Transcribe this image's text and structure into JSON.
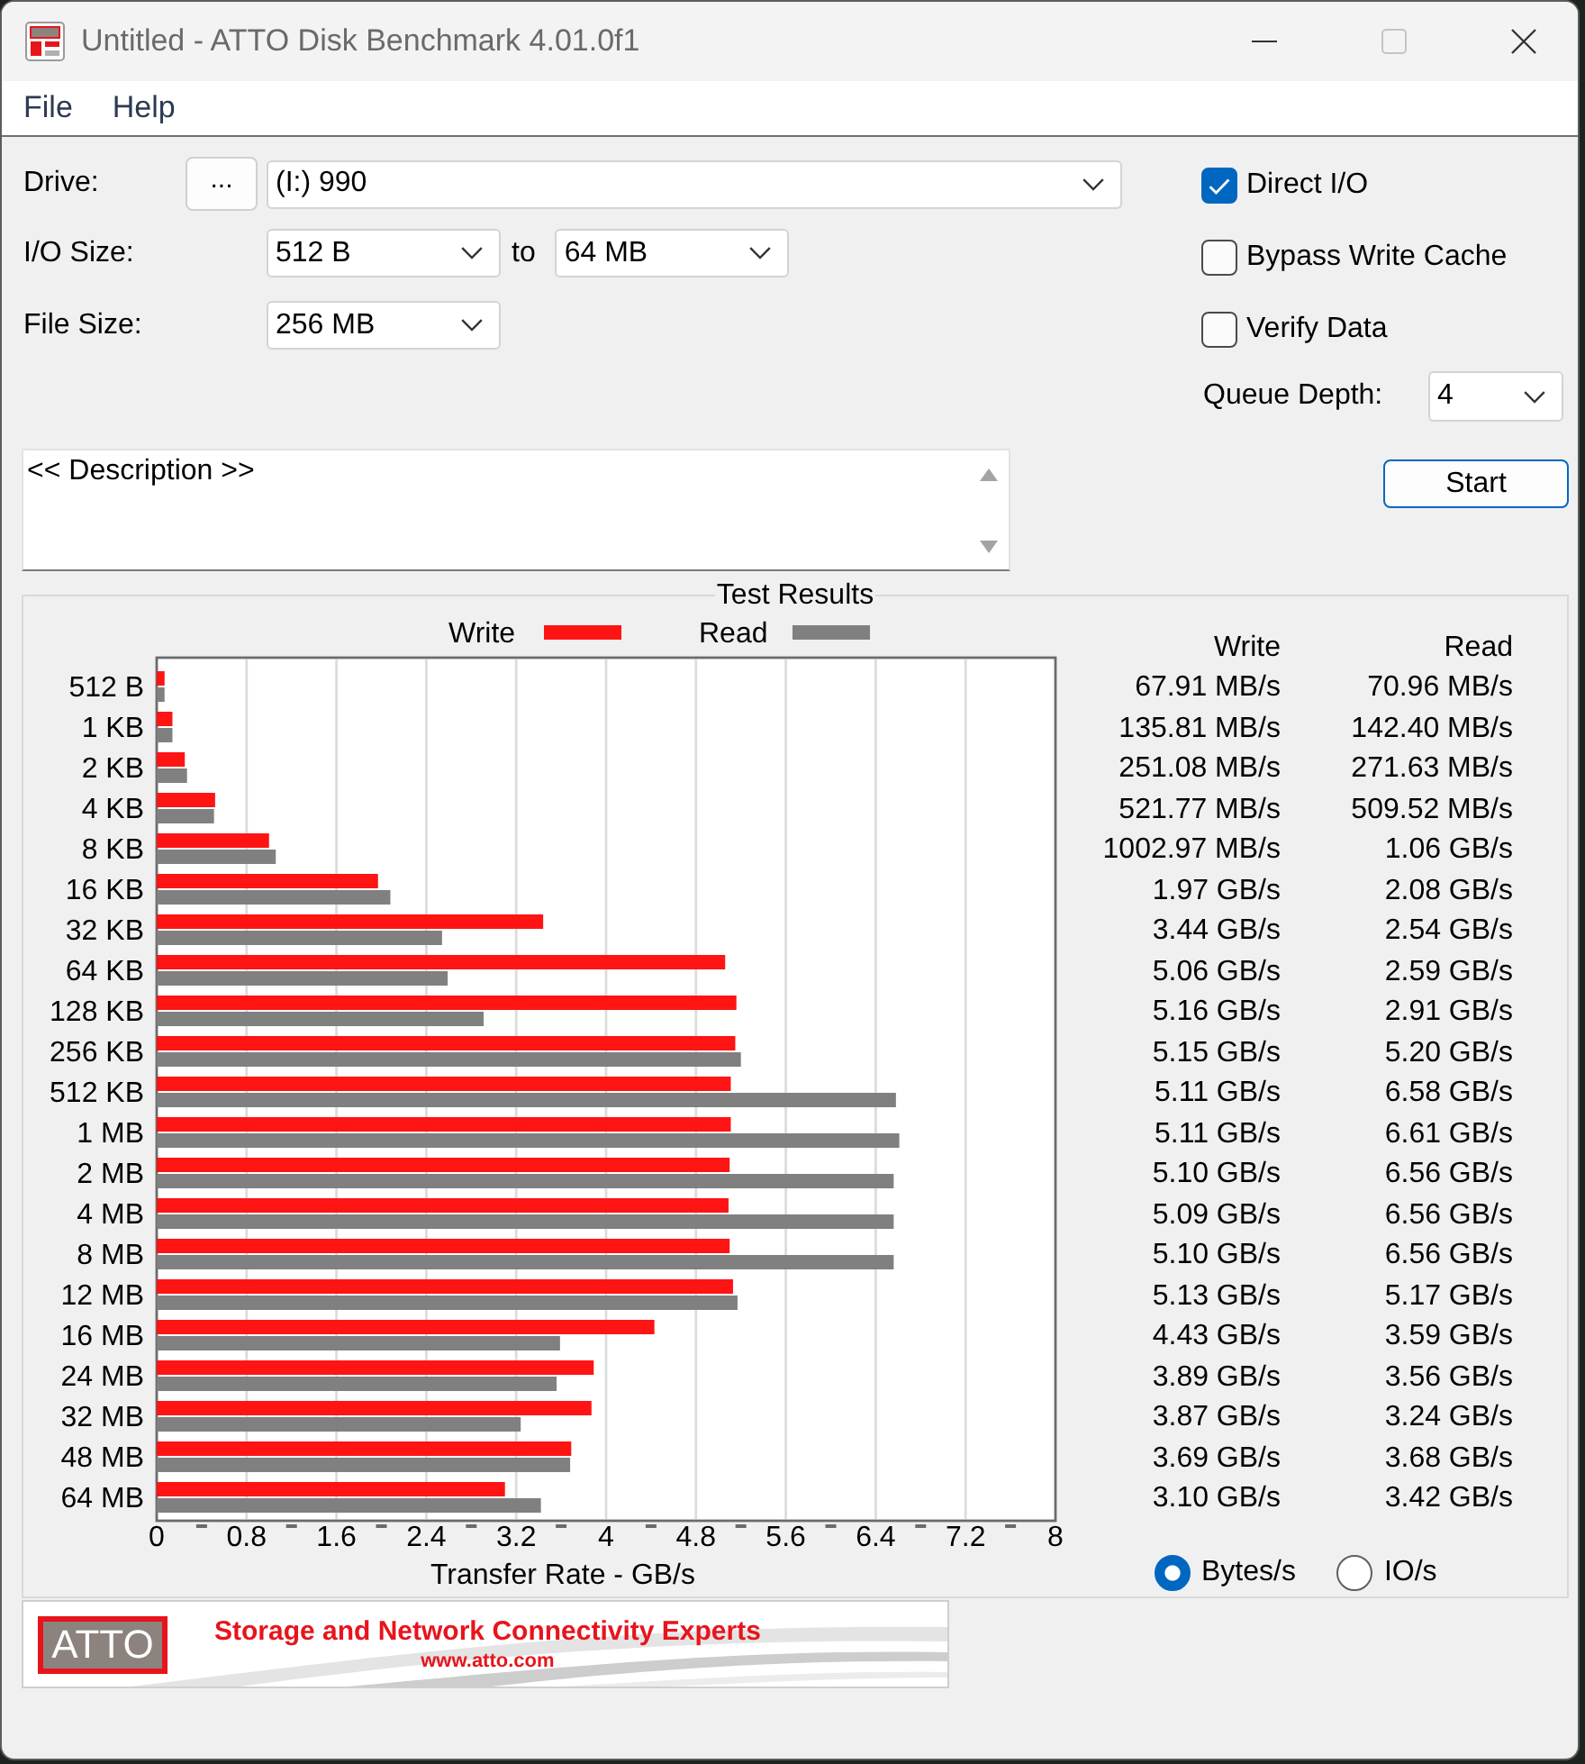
{
  "window": {
    "title": "Untitled - ATTO Disk Benchmark 4.01.0f1"
  },
  "menu": [
    "File",
    "Help"
  ],
  "drive": {
    "label": "Drive:",
    "browse_button": "...",
    "value": "(I:) 990"
  },
  "io_size": {
    "label": "I/O Size:",
    "from": "512 B",
    "separator": "to",
    "to": "64 MB"
  },
  "file_size": {
    "label": "File Size:",
    "value": "256 MB"
  },
  "description": {
    "value": "<< Description >>"
  },
  "options": [
    {
      "label": "Direct I/O",
      "checked": true
    },
    {
      "label": "Bypass Write Cache",
      "checked": false
    },
    {
      "label": "Verify Data",
      "checked": false
    }
  ],
  "queue_depth": {
    "label": "Queue Depth:",
    "value": "4"
  },
  "start_button": "Start",
  "results": {
    "title": "Test Results",
    "chart_data": {
      "type": "bar",
      "orientation": "horizontal",
      "grid": true,
      "legend": true,
      "xlabel": "Transfer Rate - GB/s",
      "categories": [
        "512 B",
        "1 KB",
        "2 KB",
        "4 KB",
        "8 KB",
        "16 KB",
        "32 KB",
        "64 KB",
        "128 KB",
        "256 KB",
        "512 KB",
        "1 MB",
        "2 MB",
        "4 MB",
        "8 MB",
        "12 MB",
        "16 MB",
        "24 MB",
        "32 MB",
        "48 MB",
        "64 MB"
      ],
      "series": [
        {
          "name": "Write",
          "color": "#ff1414",
          "values": [
            0.07,
            0.14,
            0.25,
            0.52,
            1.0,
            1.97,
            3.44,
            5.06,
            5.16,
            5.15,
            5.11,
            5.11,
            5.1,
            5.09,
            5.1,
            5.13,
            4.43,
            3.89,
            3.87,
            3.69,
            3.1
          ]
        },
        {
          "name": "Read",
          "color": "#808080",
          "values": [
            0.07,
            0.14,
            0.27,
            0.51,
            1.06,
            2.08,
            2.54,
            2.59,
            2.91,
            5.2,
            6.58,
            6.61,
            6.56,
            6.56,
            6.56,
            5.17,
            3.59,
            3.56,
            3.24,
            3.68,
            3.42
          ]
        }
      ],
      "xlim": [
        0,
        8
      ],
      "xticks": [
        0,
        0.8,
        1.6,
        2.4,
        3.2,
        {
          "value": 4,
          "label": "4"
        },
        4.8,
        5.6,
        6.4,
        7.2,
        8
      ]
    },
    "columns": [
      "Write",
      "Read"
    ],
    "rows": [
      {
        "write": "67.91 MB/s",
        "read": "70.96 MB/s"
      },
      {
        "write": "135.81 MB/s",
        "read": "142.40 MB/s"
      },
      {
        "write": "251.08 MB/s",
        "read": "271.63 MB/s"
      },
      {
        "write": "521.77 MB/s",
        "read": "509.52 MB/s"
      },
      {
        "write": "1002.97 MB/s",
        "read": "1.06 GB/s"
      },
      {
        "write": "1.97 GB/s",
        "read": "2.08 GB/s"
      },
      {
        "write": "3.44 GB/s",
        "read": "2.54 GB/s"
      },
      {
        "write": "5.06 GB/s",
        "read": "2.59 GB/s"
      },
      {
        "write": "5.16 GB/s",
        "read": "2.91 GB/s"
      },
      {
        "write": "5.15 GB/s",
        "read": "5.20 GB/s"
      },
      {
        "write": "5.11 GB/s",
        "read": "6.58 GB/s"
      },
      {
        "write": "5.11 GB/s",
        "read": "6.61 GB/s"
      },
      {
        "write": "5.10 GB/s",
        "read": "6.56 GB/s"
      },
      {
        "write": "5.09 GB/s",
        "read": "6.56 GB/s"
      },
      {
        "write": "5.10 GB/s",
        "read": "6.56 GB/s"
      },
      {
        "write": "5.13 GB/s",
        "read": "5.17 GB/s"
      },
      {
        "write": "4.43 GB/s",
        "read": "3.59 GB/s"
      },
      {
        "write": "3.89 GB/s",
        "read": "3.56 GB/s"
      },
      {
        "write": "3.87 GB/s",
        "read": "3.24 GB/s"
      },
      {
        "write": "3.69 GB/s",
        "read": "3.68 GB/s"
      },
      {
        "write": "3.10 GB/s",
        "read": "3.42 GB/s"
      }
    ],
    "units": [
      {
        "label": "Bytes/s",
        "selected": true
      },
      {
        "label": "IO/s",
        "selected": false
      }
    ]
  },
  "banner": {
    "logo": "ATTO",
    "tagline": "Storage and Network Connectivity Experts",
    "url": "www.atto.com"
  }
}
